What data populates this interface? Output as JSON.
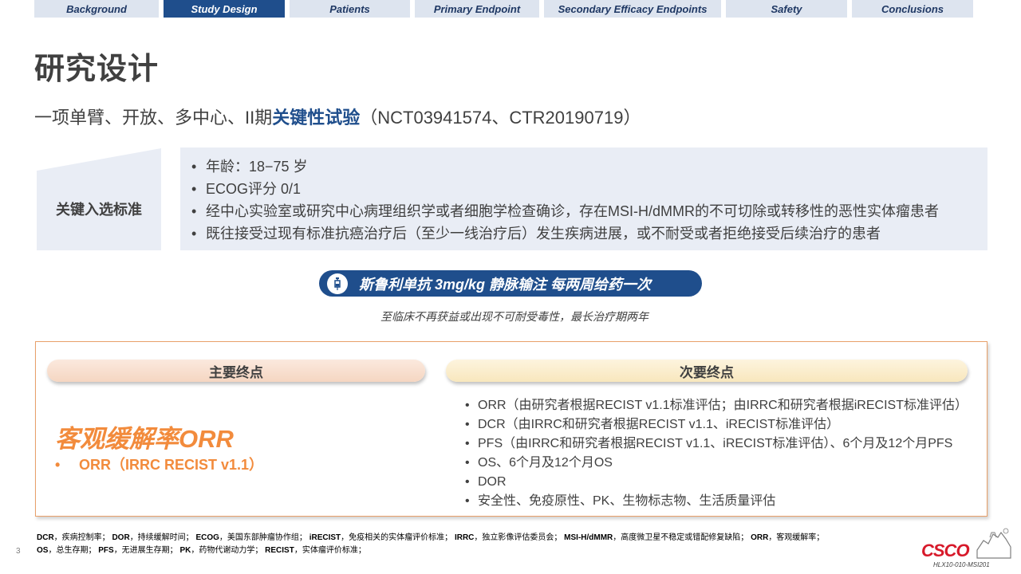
{
  "nav": {
    "tabs": [
      {
        "label": "Background",
        "active": false
      },
      {
        "label": "Study Design",
        "active": true
      },
      {
        "label": "Patients",
        "active": false
      },
      {
        "label": "Primary Endpoint",
        "active": false
      },
      {
        "label": "Secondary Efficacy Endpoints",
        "active": false
      },
      {
        "label": "Safety",
        "active": false
      },
      {
        "label": "Conclusions",
        "active": false
      }
    ]
  },
  "page_title": "研究设计",
  "subtitle": {
    "prefix": "一项单臂、开放、多中心、II期",
    "highlight": "关键性试验",
    "suffix": "（NCT03941574、CTR20190719）"
  },
  "inclusion": {
    "label": "关键入选标准",
    "items": [
      "年龄：18−75 岁",
      "ECOG评分 0/1",
      "经中心实验室或研究中心病理组织学或者细胞学检查确诊，存在MSI-H/dMMR的不可切除或转移性的恶性实体瘤患者",
      "既往接受过现有标准抗癌治疗后（至少一线治疗后）发生疾病进展，或不耐受或者拒绝接受后续治疗的患者"
    ]
  },
  "drug": {
    "icon": "syringe-icon",
    "label": "斯鲁利单抗 3mg/kg 静脉输注 每两周给药一次",
    "note": "至临床不再获益或出现不可耐受毒性，最长治疗期两年"
  },
  "endpoints": {
    "primary": {
      "header": "主要终点",
      "title": "客观缓解率ORR",
      "bullet": "•",
      "item": "ORR（IRRC RECIST v1.1）"
    },
    "secondary": {
      "header": "次要终点",
      "items": [
        "ORR（由研究者根据RECIST v1.1标准评估；由IRRC和研究者根据iRECIST标准评估）",
        "DCR（由IRRC和研究者根据RECIST v1.1、iRECIST标准评估）",
        "PFS（由IRRC和研究者根据RECIST v1.1、iRECIST标准评估）、6个月及12个月PFS",
        "OS、6个月及12个月OS",
        "DOR",
        "安全性、免疫原性、PK、生物标志物、生活质量评估"
      ]
    }
  },
  "footer": {
    "abbreviations": [
      {
        "term": "DCR",
        "def": "，疾病控制率；"
      },
      {
        "term": "DOR",
        "def": "，持续缓解时间；"
      },
      {
        "term": "ECOG",
        "def": "，美国东部肿瘤协作组；"
      },
      {
        "term": "iRECIST",
        "def": "，免疫相关的实体瘤评价标准；"
      },
      {
        "term": "IRRC",
        "def": "，独立影像评估委员会；"
      },
      {
        "term": "MSI-H/dMMR",
        "def": "，高度微卫星不稳定或错配修复缺陷；"
      },
      {
        "term": "ORR",
        "def": "，客观缓解率；"
      },
      {
        "term": "OS",
        "def": "，总生存期；"
      },
      {
        "term": "PFS",
        "def": "，无进展生存期；"
      },
      {
        "term": "PK",
        "def": "，药物代谢动力学；"
      },
      {
        "term": "RECIST",
        "def": "，实体瘤评价标准；"
      }
    ],
    "page_number": "3",
    "logo_text": "CSCO",
    "doc_code": "HLX10-010-MSI201"
  },
  "colors": {
    "brand_blue": "#1f4e8c",
    "nav_inactive": "#dde4ef",
    "accent_orange": "#f28b3c",
    "logo_red": "#d7192a"
  }
}
